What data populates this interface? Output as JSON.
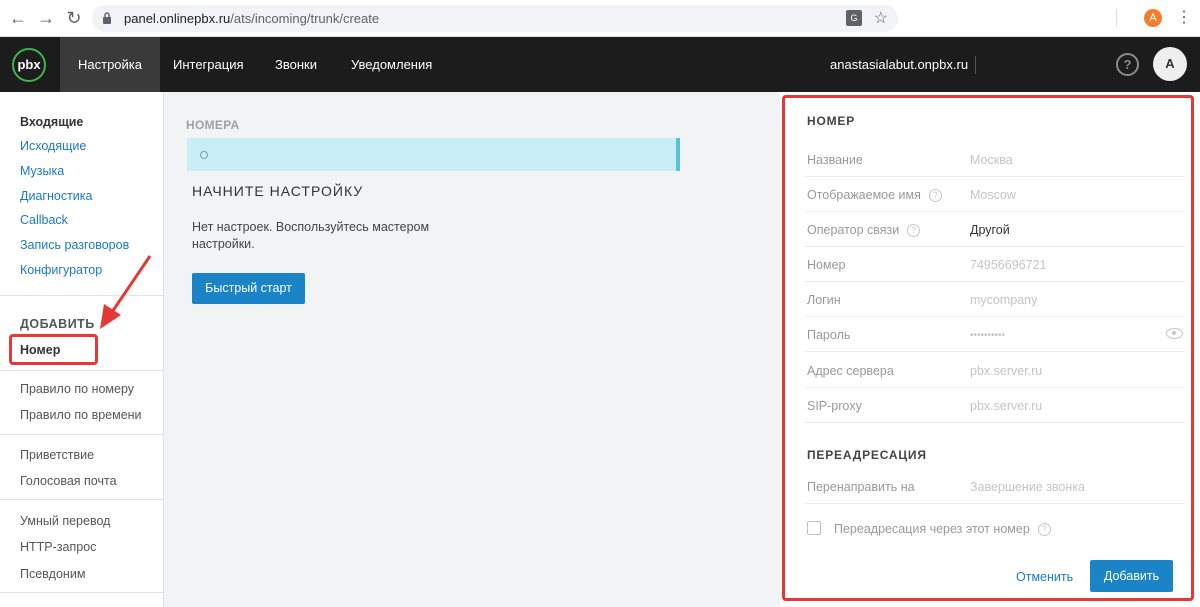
{
  "browser": {
    "back_icon": "arrow-left-icon",
    "forward_icon": "arrow-right-icon",
    "reload_icon": "reload-icon",
    "url_host": "panel.onlinepbx.ru",
    "url_path": "/ats/incoming/trunk/create",
    "profile_initial": "A"
  },
  "header": {
    "logo_text": "pbx",
    "nav": [
      {
        "label": "Настройка",
        "active": true
      },
      {
        "label": "Интеграция",
        "active": false
      },
      {
        "label": "Звонки",
        "active": false
      },
      {
        "label": "Уведомления",
        "active": false
      }
    ],
    "domain": "anastasialabut.onpbx.ru",
    "help_label": "?",
    "user_initial": "A"
  },
  "sidebar": {
    "links": [
      "Входящие",
      "Исходящие",
      "Музыка",
      "Диагностика",
      "Callback",
      "Запись разговоров",
      "Конфигуратор"
    ],
    "add_heading": "ДОБАВИТЬ",
    "add_items": [
      "Номер",
      "Правило по номеру",
      "Правило по времени",
      "Приветствие",
      "Голосовая почта",
      "Умный перевод",
      "HTTP-запрос",
      "Псевдоним"
    ]
  },
  "main": {
    "section_title": "НОМЕРА",
    "start_title": "НАЧНИТЕ НАСТРОЙКУ",
    "start_desc": "Нет настроек. Воспользуйтесь мастером настройки.",
    "quick_start_label": "Быстрый старт"
  },
  "panel": {
    "heading": "НОМЕР",
    "fields": [
      {
        "label": "Название",
        "value": "Москва",
        "placeholder": true,
        "help": false
      },
      {
        "label": "Отображаемое имя",
        "value": "Moscow",
        "placeholder": true,
        "help": true
      },
      {
        "label": "Оператор связи",
        "value": "Другой",
        "placeholder": false,
        "help": true
      },
      {
        "label": "Номер",
        "value": "74956696721",
        "placeholder": true,
        "help": false
      },
      {
        "label": "Логин",
        "value": "mycompany",
        "placeholder": true,
        "help": false
      },
      {
        "label": "Пароль",
        "value": "••••••••••",
        "placeholder": true,
        "help": false
      },
      {
        "label": "Адрес сервера",
        "value": "pbx.server.ru",
        "placeholder": true,
        "help": false
      },
      {
        "label": "SIP-proxy",
        "value": "pbx.server.ru",
        "placeholder": true,
        "help": false
      }
    ],
    "redirect_heading": "ПЕРЕАДРЕСАЦИЯ",
    "redirect_label": "Перенаправить на",
    "redirect_value": "Завершение звонка",
    "checkbox_label": "Переадресация через этот номер",
    "cancel_label": "Отменить",
    "add_label": "Добавить"
  },
  "colors": {
    "accent_blue": "#1a84c7",
    "annotation_red": "#e53935",
    "header_bg": "#1c1c1c",
    "logo_green": "#3cb54a"
  }
}
